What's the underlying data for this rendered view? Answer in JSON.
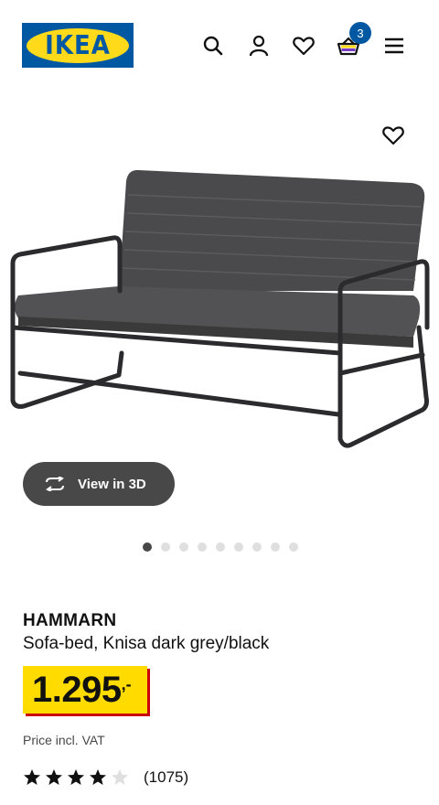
{
  "header": {
    "logo_text": "IKEA",
    "cart_count": "3"
  },
  "icons": {
    "search": "search-icon",
    "account": "user-icon",
    "wishlist": "heart-icon",
    "cart": "shopping-basket-icon",
    "menu": "hamburger-menu-icon",
    "favorite": "heart-icon",
    "rotate": "rotate-3d-icon"
  },
  "gallery": {
    "view_3d_label": "View in 3D",
    "dot_count": 9,
    "active_dot": 0
  },
  "product": {
    "name": "HAMMARN",
    "description": "Sofa-bed, Knisa dark grey/black",
    "price_main": "1.295",
    "price_suffix": ",-",
    "vat_note": "Price incl. VAT",
    "rating_value": 4,
    "rating_max": 5,
    "review_count": "(1075)"
  },
  "colors": {
    "brand_blue": "#0058a3",
    "brand_yellow": "#ffda1a",
    "price_red": "#cc0008",
    "button_dark": "#484848"
  }
}
